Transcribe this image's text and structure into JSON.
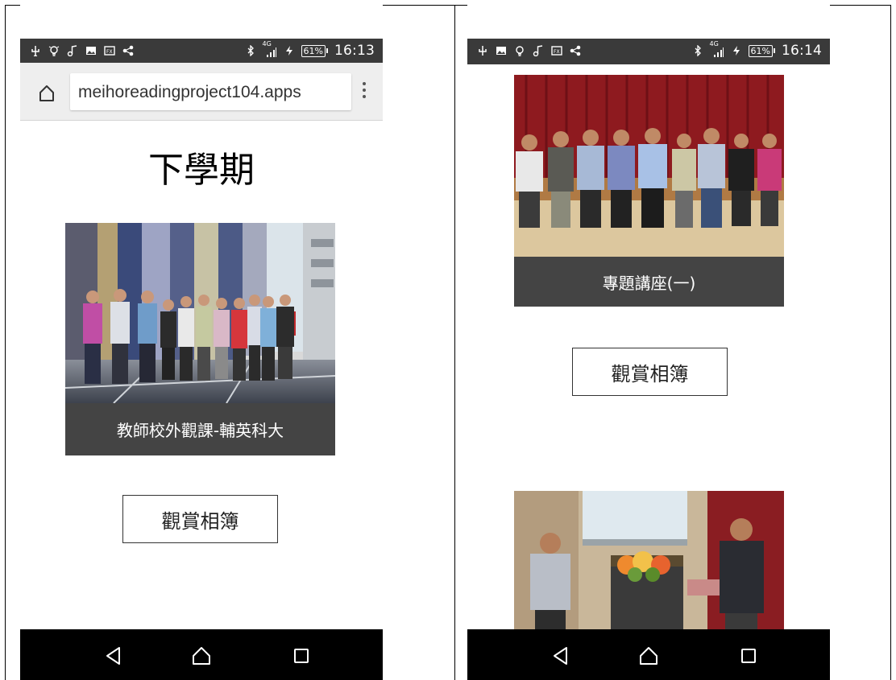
{
  "left": {
    "status": {
      "time": "16:13",
      "battery": "61%",
      "network": "4G",
      "icons": [
        "usb-icon",
        "bulb-icon",
        "music-icon",
        "image-icon",
        "gallery-icon",
        "share-icon",
        "bluetooth-icon",
        "signal-icon",
        "charging-icon"
      ]
    },
    "browser": {
      "url": "meihoreadingproject104.apps",
      "home": "home-icon",
      "menu": "more-vert-icon"
    },
    "heading": "下學期",
    "card": {
      "caption": "教師校外觀課-輔英科大"
    },
    "album_button": "觀賞相簿",
    "nav": [
      "back-icon",
      "home-icon",
      "recent-apps-icon"
    ]
  },
  "right": {
    "status": {
      "time": "16:14",
      "battery": "61%",
      "network": "4G",
      "icons": [
        "usb-icon",
        "image-icon",
        "bulb-icon",
        "music-icon",
        "gallery-icon",
        "share-icon",
        "bluetooth-icon",
        "signal-icon",
        "charging-icon"
      ]
    },
    "card": {
      "caption": "專題講座(一)"
    },
    "album_button": "觀賞相簿",
    "nav": [
      "back-icon",
      "home-icon",
      "recent-apps-icon"
    ]
  }
}
